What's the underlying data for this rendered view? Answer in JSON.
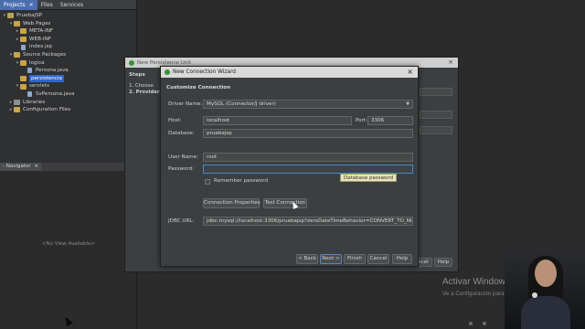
{
  "left_panel": {
    "tabs": [
      "Projects",
      "Files",
      "Services"
    ],
    "active_tab": "Projects",
    "tab_close": "×",
    "tree": [
      {
        "label": "PruebaJSP",
        "depth": 0,
        "icon": "project-icon",
        "expanded": true
      },
      {
        "label": "Web Pages",
        "depth": 1,
        "icon": "folder-icon",
        "expanded": true
      },
      {
        "label": "META-INF",
        "depth": 2,
        "icon": "folder-icon",
        "expanded": false
      },
      {
        "label": "WEB-INF",
        "depth": 2,
        "icon": "folder-icon",
        "expanded": false
      },
      {
        "label": "index.jsp",
        "depth": 2,
        "icon": "file-icon",
        "expanded": null
      },
      {
        "label": "Source Packages",
        "depth": 1,
        "icon": "folder-icon",
        "expanded": true
      },
      {
        "label": "logica",
        "depth": 2,
        "icon": "package-icon",
        "expanded": true
      },
      {
        "label": "Persona.java",
        "depth": 3,
        "icon": "file-icon",
        "expanded": null
      },
      {
        "label": "persistencia",
        "depth": 2,
        "icon": "package-icon",
        "expanded": null,
        "selected": true
      },
      {
        "label": "servlets",
        "depth": 2,
        "icon": "package-icon",
        "expanded": true
      },
      {
        "label": "SvPersona.java",
        "depth": 3,
        "icon": "file-icon",
        "expanded": null
      },
      {
        "label": "Libraries",
        "depth": 1,
        "icon": "library-icon",
        "expanded": false
      },
      {
        "label": "Configuration Files",
        "depth": 1,
        "icon": "folder-icon",
        "expanded": false
      }
    ]
  },
  "navigator": {
    "tab": "- Navigator",
    "tab_close": "×",
    "empty_text": "<No View Available>"
  },
  "back_dialog": {
    "title": "New Persistence Unit",
    "close": "×",
    "steps_heading": "Steps",
    "steps": [
      "1.  Choose",
      "2.  Provider"
    ],
    "cancel_label": "ncel",
    "help_label": "Help"
  },
  "wizard": {
    "title": "New Connection Wizard",
    "close": "×",
    "section": "Customize Connection",
    "driver_label": "Driver Name:",
    "driver_value": "MySQL (Connector/J driver)",
    "host_label": "Host:",
    "host_value": "localhost",
    "port_label": "Port:",
    "port_value": "3306",
    "database_label": "Database:",
    "database_value": "pruebajsp",
    "username_label": "User Name:",
    "username_value": "root",
    "password_label": "Password:",
    "password_value": "",
    "remember_label": "Remember password",
    "remember_checked": false,
    "tooltip": "Database password",
    "connection_properties_label": "Connection Properties",
    "test_connection_label": "Test Connection",
    "jdbc_label": "JDBC URL:",
    "jdbc_value": "jdbc:mysql://localhost:3306/pruebajsp?zeroDateTimeBehavior=CONVERT_TO_NULL",
    "buttons": {
      "back": "< Back",
      "next": "Next >",
      "finish": "Finish",
      "cancel": "Cancel",
      "help": "Help"
    }
  },
  "windows_activation": {
    "title": "Activar Windows",
    "subtitle": "Ve a Configuración para"
  },
  "colors": {
    "ide_background": "#2b2b2b",
    "dialog_background": "#3c3f41",
    "selection": "#2f65ca",
    "focus_border": "#4a88c7",
    "tooltip_background": "#e9e4b8"
  }
}
